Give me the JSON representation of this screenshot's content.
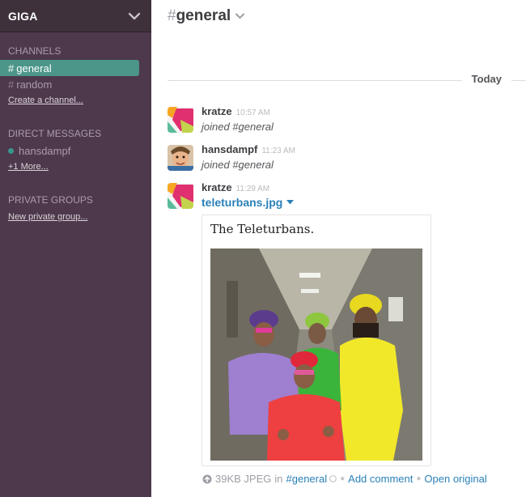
{
  "team": {
    "name": "GIGA"
  },
  "sidebar": {
    "channels_title": "CHANNELS",
    "channels": [
      {
        "hash": "#",
        "name": "general",
        "active": true
      },
      {
        "hash": "#",
        "name": "random",
        "active": false
      }
    ],
    "create_channel": "Create a channel...",
    "dm_title": "DIRECT MESSAGES",
    "dms": [
      {
        "name": "hansdampf"
      }
    ],
    "more_dms": "+1 More...",
    "groups_title": "PRIVATE GROUPS",
    "new_group": "New private group..."
  },
  "header": {
    "hash": "#",
    "channel": "general"
  },
  "day_divider": "Today",
  "messages": [
    {
      "author": "kratze",
      "time": "10:57 AM",
      "text": "joined #general"
    },
    {
      "author": "hansdampf",
      "time": "11:23 AM",
      "text": "joined #general"
    },
    {
      "author": "kratze",
      "time": "11:29 AM",
      "file_name": "teleturbans.jpg",
      "file_caption": "The Teleturbans."
    }
  ],
  "file_meta": {
    "size_type": "39KB JPEG",
    "in_word": "in",
    "channel": "#general",
    "add_comment": "Add comment",
    "open_original": "Open original"
  },
  "colors": {
    "sidebar_bg": "#4d394b",
    "active_channel": "#4c9689",
    "link": "#2a80b9"
  }
}
